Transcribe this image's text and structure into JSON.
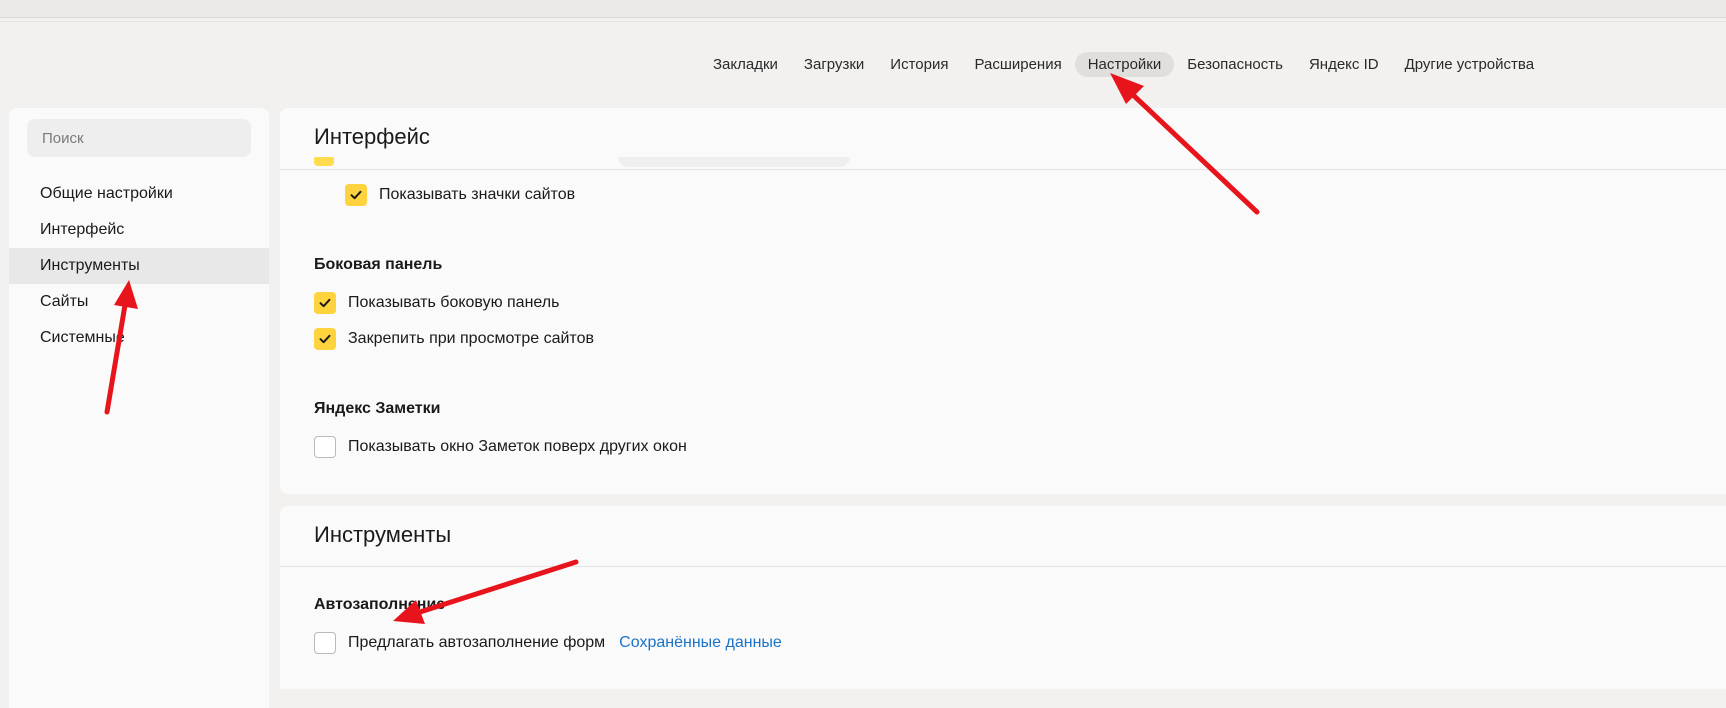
{
  "tabs": [
    {
      "label": "Закладки"
    },
    {
      "label": "Загрузки"
    },
    {
      "label": "История"
    },
    {
      "label": "Расширения"
    },
    {
      "label": "Настройки",
      "active": true
    },
    {
      "label": "Безопасность"
    },
    {
      "label": "Яндекс ID"
    },
    {
      "label": "Другие устройства"
    }
  ],
  "sidebar": {
    "search_placeholder": "Поиск",
    "items": [
      {
        "label": "Общие настройки"
      },
      {
        "label": "Интерфейс"
      },
      {
        "label": "Инструменты",
        "active": true
      },
      {
        "label": "Сайты"
      },
      {
        "label": "Системные"
      }
    ]
  },
  "interface": {
    "title": "Интерфейс",
    "show_site_icons": {
      "label": "Показывать значки сайтов",
      "checked": true
    },
    "side_panel": {
      "heading": "Боковая панель",
      "show_panel": {
        "label": "Показывать боковую панель",
        "checked": true
      },
      "pin_panel": {
        "label": "Закрепить при просмотре сайтов",
        "checked": true
      }
    },
    "notes": {
      "heading": "Яндекс Заметки",
      "show_on_top": {
        "label": "Показывать окно Заметок поверх других окон",
        "checked": false
      }
    }
  },
  "tools": {
    "title": "Инструменты",
    "autofill": {
      "heading": "Автозаполнение",
      "offer_autofill": {
        "label": "Предлагать автозаполнение форм",
        "checked": false
      },
      "saved_data_link": "Сохранённые данные"
    }
  },
  "colors": {
    "accent_checkbox": "#ffd33d",
    "link": "#1a73c9",
    "annotation_arrow": "#e8141c"
  }
}
